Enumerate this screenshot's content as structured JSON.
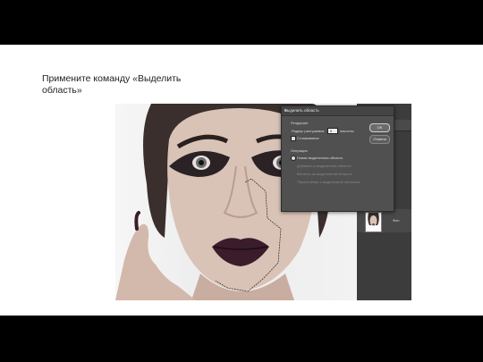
{
  "caption": "Примените команду «Выделить область»",
  "photoshop": {
    "panel_tabs": [
      "Слои",
      "Каналы"
    ],
    "layer_name": "Фон"
  },
  "dialog": {
    "title": "Выделить область",
    "section_render": "Рендеринг",
    "feather_label": "Радиус растушевки:",
    "feather_value": "0",
    "feather_unit": "пикселы",
    "antialias_label": "Сглаживание",
    "section_operation": "Операция",
    "op_new": "Новая выделенная область",
    "op_add": "Добавить к выделенной области",
    "op_subtract": "Вычесть из выделенной области",
    "op_intersect": "Пересечение с выделенной областью",
    "ok_label": "OK",
    "cancel_label": "Отмена"
  }
}
